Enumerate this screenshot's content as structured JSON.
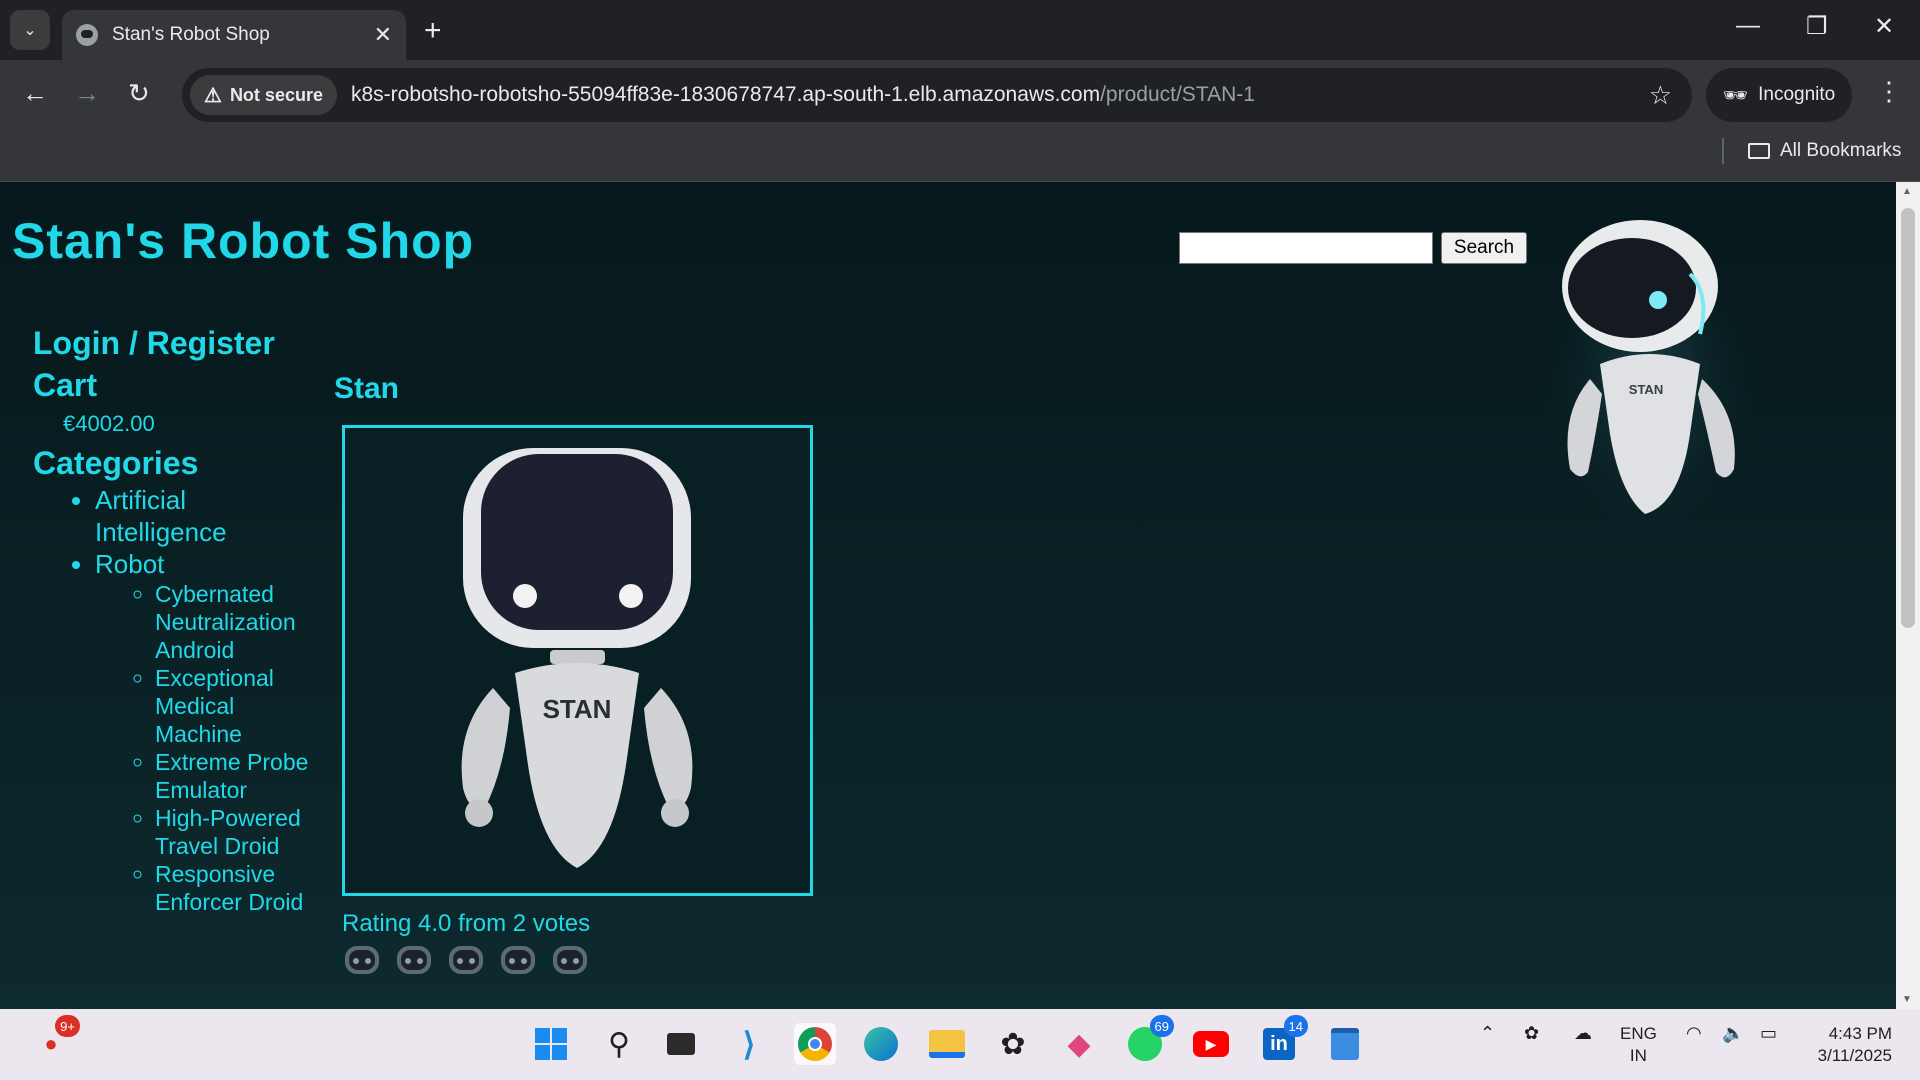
{
  "browser": {
    "tab_title": "Stan's Robot Shop",
    "tab_close": "✕",
    "new_tab": "+",
    "not_secure_label": "Not secure",
    "url_host": "k8s-robotsho-robotsho-55094ff83e-1830678747.ap-south-1.elb.amazonaws.com",
    "url_path": "/product/STAN-1",
    "incognito_label": "Incognito",
    "all_bookmarks_label": "All Bookmarks"
  },
  "page": {
    "shop_title": "Stan's Robot Shop",
    "search_button_label": "Search",
    "search_value": "",
    "nav_login": "Login / Register",
    "nav_cart": "Cart",
    "cart_total": "€4002.00",
    "categories_heading": "Categories",
    "categories": {
      "ai": "Artificial Intelligence",
      "robot": "Robot",
      "robot_sub": [
        "Cybernated Neutralization Android",
        "Exceptional Medical Machine",
        "Extreme Probe Emulator",
        "High-Powered Travel Droid",
        "Responsive Enforcer Droid"
      ]
    },
    "product_name": "Stan",
    "product_image_label": "STAN",
    "mascot_label": "STAN",
    "rating_text": "Rating 4.0 from 2 votes",
    "vote_count": 5
  },
  "taskbar": {
    "notif_badge": "9+",
    "whatsapp_badge": "69",
    "linkedin_badge": "14",
    "lang_line1": "ENG",
    "lang_line2": "IN",
    "time": "4:43 PM",
    "date": "3/11/2025"
  },
  "colors": {
    "accent": "#21d8e8",
    "page_bg": "#0a2226"
  }
}
